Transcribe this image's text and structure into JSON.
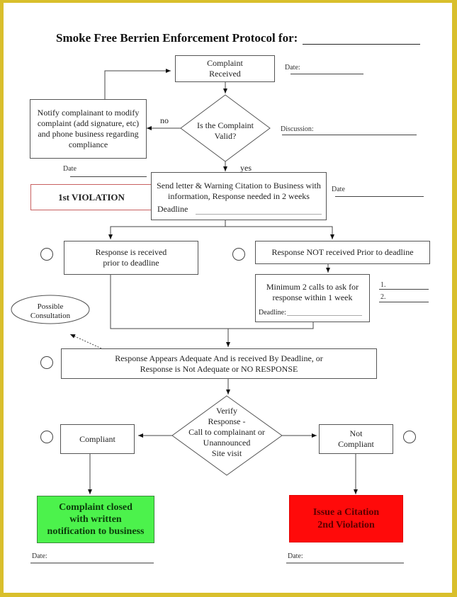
{
  "title": "Smoke Free Berrien Enforcement Protocol for:",
  "nodes": {
    "complaint_received": "Complaint\nReceived",
    "notify_complainant": "Notify complainant to modify complaint (add signature, etc) and phone business regarding compliance",
    "is_valid": "Is the Complaint\nValid?",
    "send_letter": "Send letter & Warning Citation to Business with information, Response needed in 2 weeks",
    "send_letter_deadline": "Deadline",
    "first_violation": "1st VIOLATION",
    "response_received": "Response is received\nprior to deadline",
    "response_not_received": "Response NOT received Prior to deadline",
    "min_calls": "Minimum 2 calls to ask for\nresponse within 1 week",
    "min_calls_deadline": "Deadline:",
    "possible_consultation": "Possible\nConsultation",
    "response_adequate": "Response Appears Adequate And is received By Deadline, or\nResponse is Not Adequate or NO RESPONSE",
    "verify_response": "Verify\nResponse -\nCall to complainant or\nUnannounced\nSite visit",
    "compliant": "Compliant",
    "not_compliant": "Not\nCompliant",
    "complaint_closed": "Complaint closed\nwith written\nnotification to business",
    "issue_citation": "Issue a Citation\n2nd Violation"
  },
  "edge_labels": {
    "no": "no",
    "yes": "yes"
  },
  "fields": {
    "date_top": "Date:",
    "discussion": "Discussion:",
    "date_left": "Date",
    "date_right": "Date",
    "call_1": "1.",
    "call_2": "2.",
    "date_bottom_left": "Date:",
    "date_bottom_right": "Date:"
  },
  "colors": {
    "frame": "#d9bf2c",
    "closed_fill": "#4cf24c",
    "closed_text": "#0b3d0b",
    "citation_fill": "#ff0a0a",
    "citation_text": "#5a0000",
    "violation_border": "#c86060"
  }
}
